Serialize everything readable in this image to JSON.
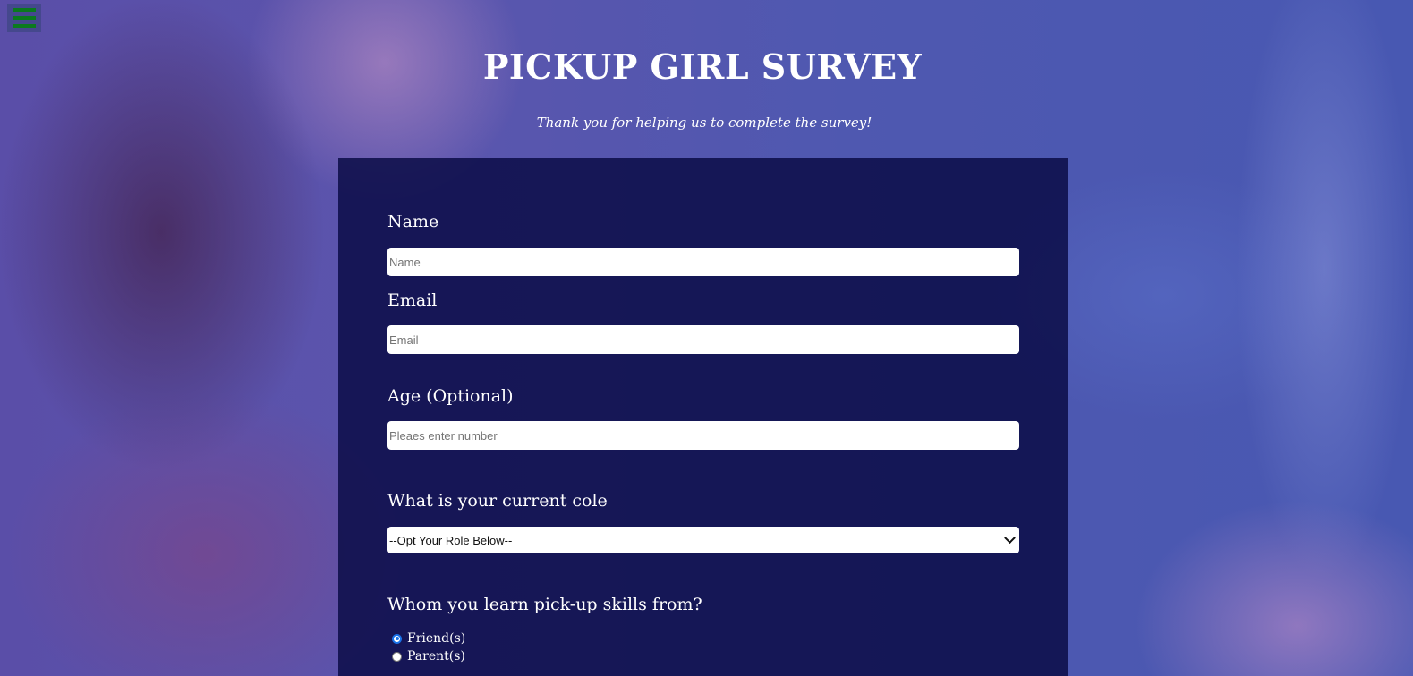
{
  "header": {
    "title": "PICKUP GIRL SURVEY",
    "subtitle": "Thank you for helping us to complete the survey!"
  },
  "menu": {
    "icon": "hamburger-icon",
    "color": "#0b7a1e"
  },
  "form": {
    "name_label": "Name",
    "name_placeholder": "Name",
    "email_label": "Email",
    "email_placeholder": "Email",
    "age_label": "Age (Optional)",
    "age_placeholder": "Pleaes enter number",
    "role_label": "What is your current cole",
    "role_selected": "--Opt Your Role Below--",
    "learn_label": "Whom you learn pick-up skills from?",
    "learn_options": [
      {
        "label": "Friend(s)",
        "checked": true
      },
      {
        "label": "Parent(s)",
        "checked": false
      }
    ]
  }
}
